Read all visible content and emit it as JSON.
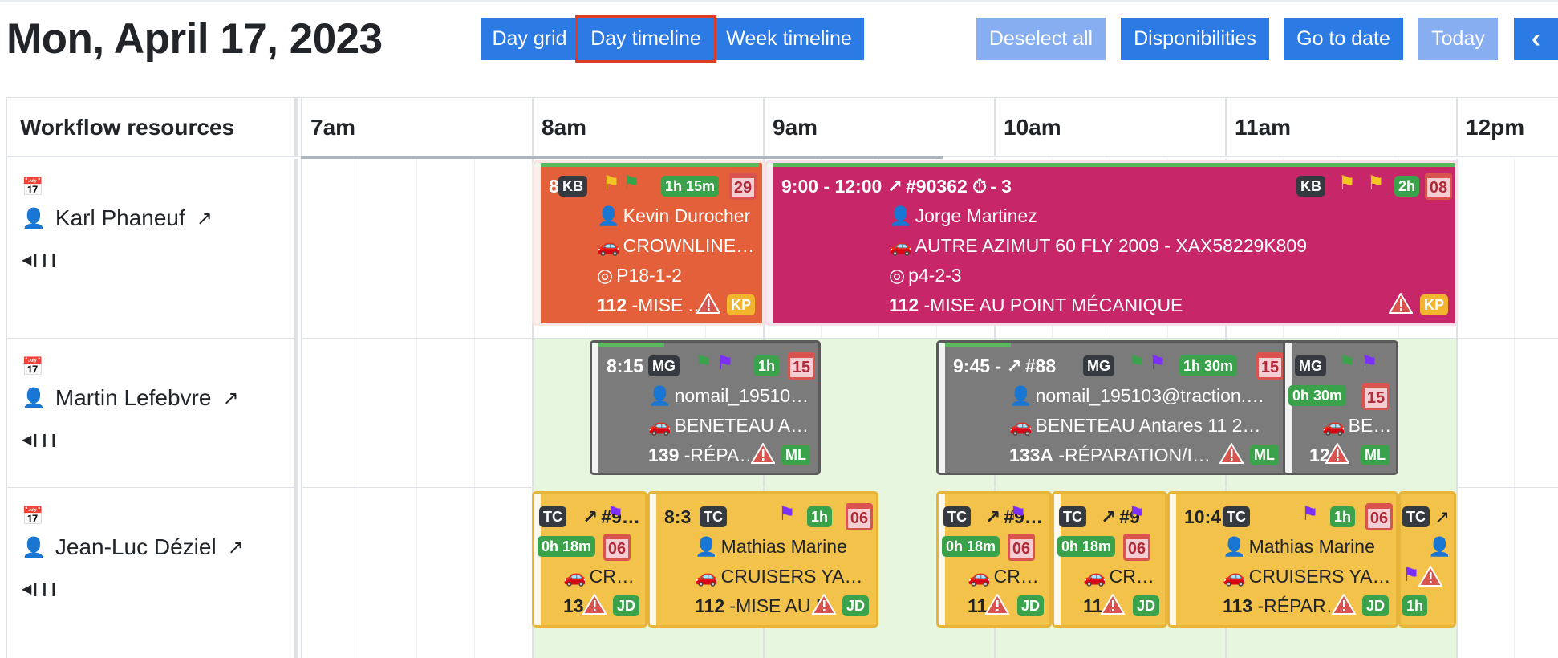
{
  "header": {
    "date_title": "Mon, April 17, 2023",
    "views": [
      "Day grid",
      "Day timeline",
      "Week timeline"
    ],
    "selected_view": "Day timeline",
    "actions": {
      "deselect_all": "Deselect all",
      "disponibilities": "Disponibilities",
      "go_to_date": "Go to date",
      "today": "Today",
      "prev": "‹"
    }
  },
  "grid": {
    "resources_header": "Workflow resources",
    "hours": [
      "7am",
      "8am",
      "9am",
      "10am",
      "11am",
      "12pm"
    ]
  },
  "resources": [
    {
      "name": "Karl Phaneuf",
      "person_color": "#9b4dca",
      "events": [
        {
          "color": "orange",
          "time": "8",
          "tech": "KB",
          "duration": "1h 15m",
          "day": "29",
          "client": "Kevin Durocher",
          "vehicle": "CROWNLINE …",
          "location": "P18-1-2",
          "code": "112",
          "task": "-MISE AU P",
          "assignee": "KP"
        },
        {
          "color": "magenta",
          "time": "9:00 - 12:00",
          "order": "#90362",
          "count": "- 3",
          "tech": "KB",
          "duration": "2h",
          "day": "08",
          "client": "Jorge Martinez",
          "vehicle": "AUTRE AZIMUT 60 FLY 2009 - XAX58229K809",
          "location": "p4-2-3",
          "code": "112",
          "task": "-MISE AU POINT MÉCANIQUE",
          "assignee": "KP"
        }
      ]
    },
    {
      "name": "Martin Lefebvre",
      "person_color": "#3aa24a",
      "events": [
        {
          "color": "gray",
          "time": "8:15",
          "tech": "MG",
          "duration": "1h",
          "day": "15",
          "client": "nomail_19510…",
          "vehicle": "BENETEAU A…",
          "code": "139",
          "task": "-RÉPARAT",
          "assignee": "ML"
        },
        {
          "color": "gray",
          "time": "9:45 -",
          "order": "#88",
          "tech": "MG",
          "duration": "1h 30m",
          "day": "15",
          "client": "nomail_195103@traction.…",
          "vehicle": "BENETEAU Antares 11 2…",
          "code": "133A",
          "task": "-RÉPARATION/INST",
          "assignee": "ML"
        },
        {
          "color": "gray",
          "tech": "MG",
          "duration": "0h 30m",
          "day": "15",
          "vehicle": "BE…",
          "code": "12",
          "assignee": "ML"
        }
      ]
    },
    {
      "name": "Jean-Luc Déziel",
      "person_color": "#3aa24a",
      "events": [
        {
          "color": "yellow",
          "tech": "TC",
          "order": "#9103",
          "duration": "0h 18m",
          "day": "06",
          "vehicle": "CR…",
          "code": "13",
          "assignee": "JD"
        },
        {
          "color": "yellow",
          "time": "8:3",
          "tech": "TC",
          "duration": "1h",
          "day": "06",
          "client": "Mathias Marine",
          "vehicle": "CRUISERS YA…",
          "code": "112",
          "task": "-MISE AU P",
          "assignee": "JD"
        },
        {
          "color": "yellow",
          "tech": "TC",
          "order": "#9103",
          "duration": "0h 18m",
          "day": "06",
          "vehicle": "CR…",
          "code": "11",
          "assignee": "JD"
        },
        {
          "color": "yellow",
          "tech": "TC",
          "order": "#9",
          "duration": "0h 18m",
          "day": "06",
          "vehicle": "CR…",
          "code": "11",
          "assignee": "JD"
        },
        {
          "color": "yellow",
          "time": "10:4",
          "tech": "TC",
          "duration": "1h",
          "day": "06",
          "client": "Mathias Marine",
          "vehicle": "CRUISERS YA…",
          "code": "113",
          "task": "-RÉPARATI",
          "assignee": "JD"
        },
        {
          "color": "yellow",
          "tech": "TC",
          "duration": "1h",
          "client": "…"
        }
      ]
    }
  ],
  "colors": {
    "primary": "#2c7be5",
    "primary_light": "#86aef1",
    "selected_outline": "#e03b24",
    "available": "#e7f6df",
    "orange": "#e4603a",
    "magenta": "#c72668",
    "gray": "#7b7b7b",
    "yellow": "#f2c24a",
    "green_chip": "#3aa24a"
  }
}
